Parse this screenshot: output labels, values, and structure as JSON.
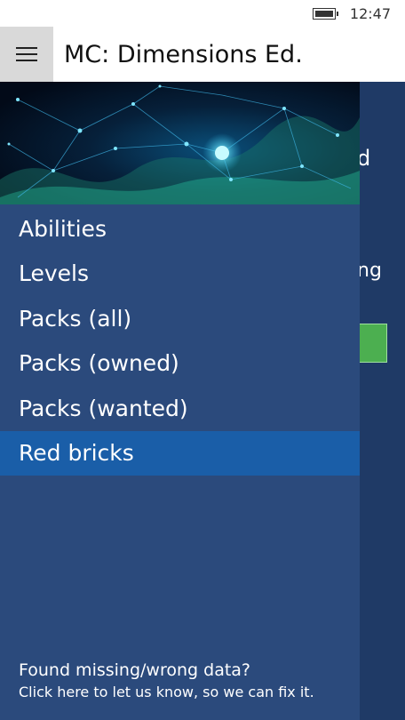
{
  "status_bar": {
    "time": "12:47",
    "battery_icon": "battery-icon"
  },
  "header": {
    "menu_icon": "hamburger-icon",
    "title": "MC: Dimensions Ed."
  },
  "background_page": {
    "partial_text_1": "d",
    "partial_text_2": "ng",
    "accent": "#4caf50"
  },
  "drawer": {
    "items": [
      {
        "label": "Abilities"
      },
      {
        "label": "Levels"
      },
      {
        "label": "Packs (all)"
      },
      {
        "label": "Packs (owned)"
      },
      {
        "label": "Packs (wanted)"
      },
      {
        "label": "Red bricks",
        "selected": true
      }
    ],
    "feedback": {
      "title": "Found missing/wrong data?",
      "subtitle": "Click here to let us know, so we can fix it."
    }
  },
  "colors": {
    "drawer_bg": "#2b4a7c",
    "selected_bg": "#1a5ea8",
    "page_bg": "#1f3a66"
  }
}
